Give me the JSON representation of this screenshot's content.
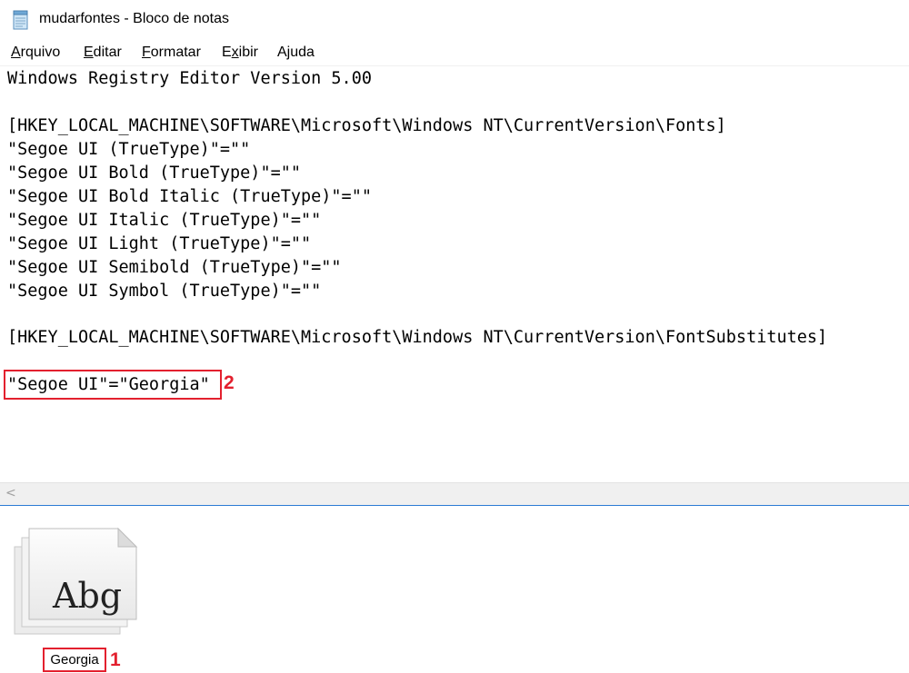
{
  "window": {
    "title": "mudarfontes - Bloco de notas",
    "icon": "notepad-icon"
  },
  "menu": {
    "items": [
      {
        "label": "Arquivo",
        "accel": "A"
      },
      {
        "label": "Editar",
        "accel": "E"
      },
      {
        "label": "Formatar",
        "accel": "F"
      },
      {
        "label": "Exibir",
        "accel": "x"
      },
      {
        "label": "Ajuda",
        "accel": "j"
      }
    ]
  },
  "editor": {
    "lines": [
      "Windows Registry Editor Version 5.00",
      "",
      "[HKEY_LOCAL_MACHINE\\SOFTWARE\\Microsoft\\Windows NT\\CurrentVersion\\Fonts]",
      "\"Segoe UI (TrueType)\"=\"\"",
      "\"Segoe UI Bold (TrueType)\"=\"\"",
      "\"Segoe UI Bold Italic (TrueType)\"=\"\"",
      "\"Segoe UI Italic (TrueType)\"=\"\"",
      "\"Segoe UI Light (TrueType)\"=\"\"",
      "\"Segoe UI Semibold (TrueType)\"=\"\"",
      "\"Segoe UI Symbol (TrueType)\"=\"\"",
      "",
      "[HKEY_LOCAL_MACHINE\\SOFTWARE\\Microsoft\\Windows NT\\CurrentVersion\\FontSubstitutes]",
      "",
      "\"Segoe UI\"=\"Georgia\""
    ]
  },
  "annotations": {
    "step1": "1",
    "step2": "2"
  },
  "file": {
    "thumbnail_text": "Abg",
    "name": "Georgia",
    "icon": "font-file-icon"
  },
  "colors": {
    "annotation": "#e3202e",
    "window_border": "#2b7bd4"
  }
}
